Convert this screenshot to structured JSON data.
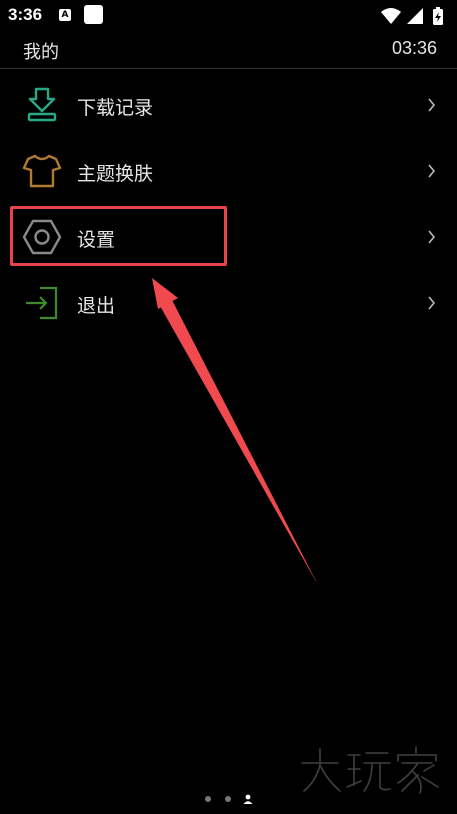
{
  "status_bar": {
    "time": "3:36",
    "a_icon_letter": "A"
  },
  "header": {
    "title": "我的",
    "time": "03:36"
  },
  "menu": {
    "items": [
      {
        "label": "下载记录",
        "icon": "download-icon",
        "color": "#2aa886"
      },
      {
        "label": "主题换肤",
        "icon": "shirt-icon",
        "color": "#b07a30"
      },
      {
        "label": "设置",
        "icon": "hex-nut-icon",
        "color": "#8a8a8a"
      },
      {
        "label": "退出",
        "icon": "exit-icon",
        "color": "#3e8a2c"
      }
    ]
  },
  "annotation": {
    "highlight_color": "#e8434a",
    "arrow_color": "#f04a4f"
  },
  "page_indicator": {
    "count": 3,
    "active_index": 2
  },
  "watermark": {
    "text": "大玩家"
  }
}
